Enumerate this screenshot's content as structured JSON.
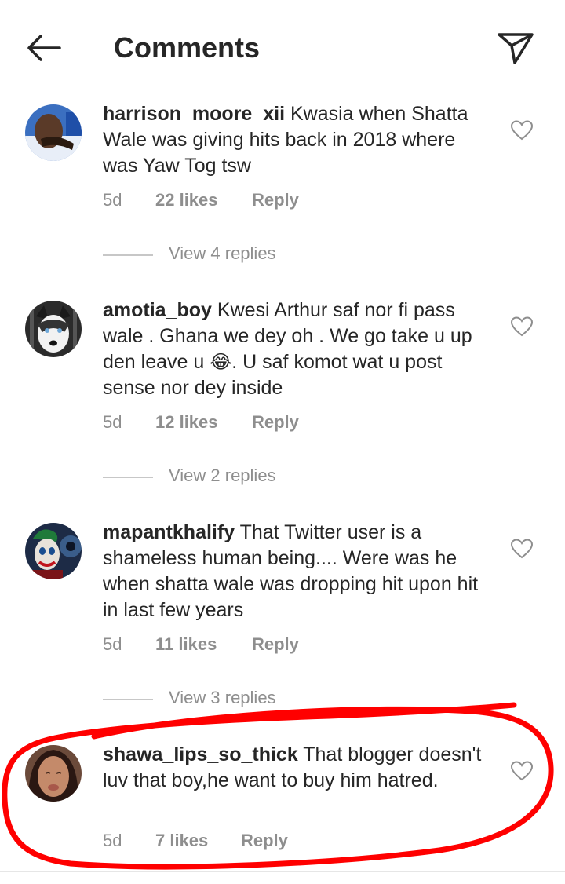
{
  "header": {
    "title": "Comments"
  },
  "comments": [
    {
      "username": "harrison_moore_xii",
      "text": "Kwasia when Shatta Wale was giving hits back in 2018 where was Yaw Tog tsw",
      "time": "5d",
      "likes": "22 likes",
      "reply": "Reply",
      "view_replies": "View 4 replies"
    },
    {
      "username": "amotia_boy",
      "text_before_emoji": "Kwesi Arthur saf nor fi pass wale . Ghana we dey oh . We go take u up den leave u ",
      "emoji": "😂",
      "text_after_emoji": ". U saf komot wat u post sense nor dey inside",
      "time": "5d",
      "likes": "12 likes",
      "reply": "Reply",
      "view_replies": "View 2 replies"
    },
    {
      "username": "mapantkhalify",
      "text": "That Twitter user is a shameless human being.... Were was he when shatta wale was dropping hit upon hit in last few years",
      "time": "5d",
      "likes": "11 likes",
      "reply": "Reply",
      "view_replies": "View 3 replies"
    },
    {
      "username": "shawa_lips_so_thick",
      "text": "That blogger doesn't luv that boy,he want to buy him hatred.",
      "time": "5d",
      "likes": "7 likes",
      "reply": "Reply"
    }
  ],
  "colors": {
    "text": "#262626",
    "secondary": "#8e8e8e",
    "annotation": "#ff0000"
  },
  "icons": [
    "back-arrow-icon",
    "send-icon",
    "heart-icon"
  ]
}
